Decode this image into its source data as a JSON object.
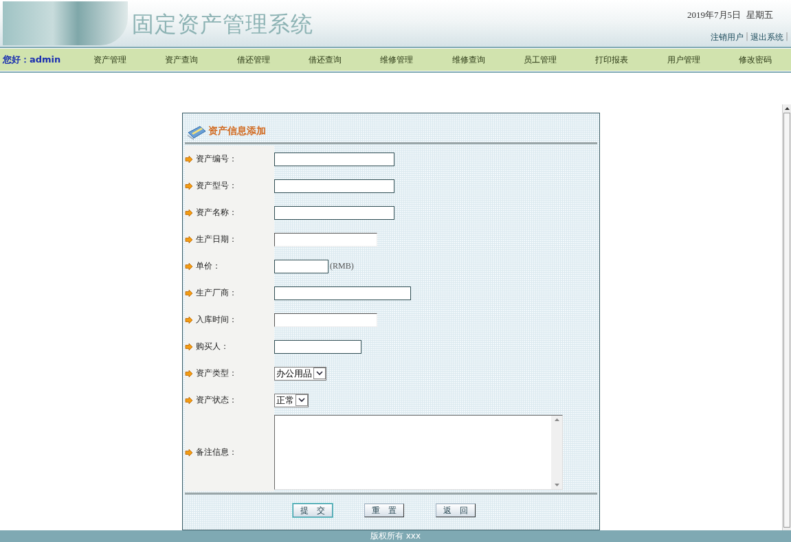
{
  "header": {
    "title": "固定资产管理系统",
    "date": "2019年7月5日",
    "weekday": "星期五",
    "links": [
      {
        "label": "注销用户",
        "separator": "|"
      },
      {
        "label": "退出系统",
        "separator": "|"
      }
    ]
  },
  "nav": {
    "greeting": "您好：admin",
    "items": [
      "资产管理",
      "资产查询",
      "借还管理",
      "借还查询",
      "维修管理",
      "维修查询",
      "员工管理",
      "打印报表",
      "用户管理",
      "修改密码"
    ]
  },
  "form": {
    "title": "资产信息添加",
    "fields": [
      {
        "kind": "text",
        "label": "资产编号："
      },
      {
        "kind": "text",
        "label": "资产型号："
      },
      {
        "kind": "text",
        "label": "资产名称："
      },
      {
        "kind": "date",
        "label": "生产日期："
      },
      {
        "kind": "text",
        "label": "单价：",
        "suffix": "(RMB)"
      },
      {
        "kind": "text",
        "label": "生产厂商："
      },
      {
        "kind": "date",
        "label": "入库时间："
      },
      {
        "kind": "text",
        "label": "购买人："
      },
      {
        "kind": "select",
        "label": "资产类型：",
        "value": "办公用品"
      },
      {
        "kind": "select",
        "label": "资产状态：",
        "value": "正常"
      },
      {
        "kind": "textarea",
        "label": "备注信息："
      }
    ],
    "buttons": [
      "提　交",
      "重　置",
      "返　回"
    ]
  },
  "footer": {
    "text": "版权所有 xxx"
  }
}
